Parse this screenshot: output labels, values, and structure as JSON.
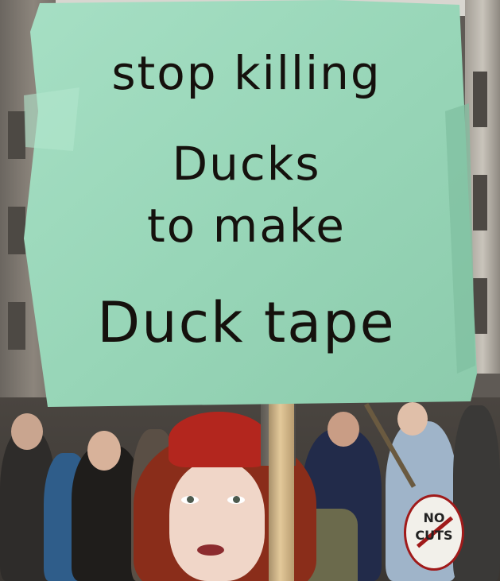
{
  "photo": {
    "sign": {
      "lines": [
        "stop killing",
        "Ducks",
        "to make",
        "Duck tape"
      ],
      "board_color": "#9fd9bd",
      "ink_color": "#15110d"
    },
    "placard": {
      "lines": [
        "NO",
        "CUTS"
      ]
    },
    "subjects": [
      "protester-woman-icon",
      "crowd-icon",
      "building-icon"
    ]
  }
}
